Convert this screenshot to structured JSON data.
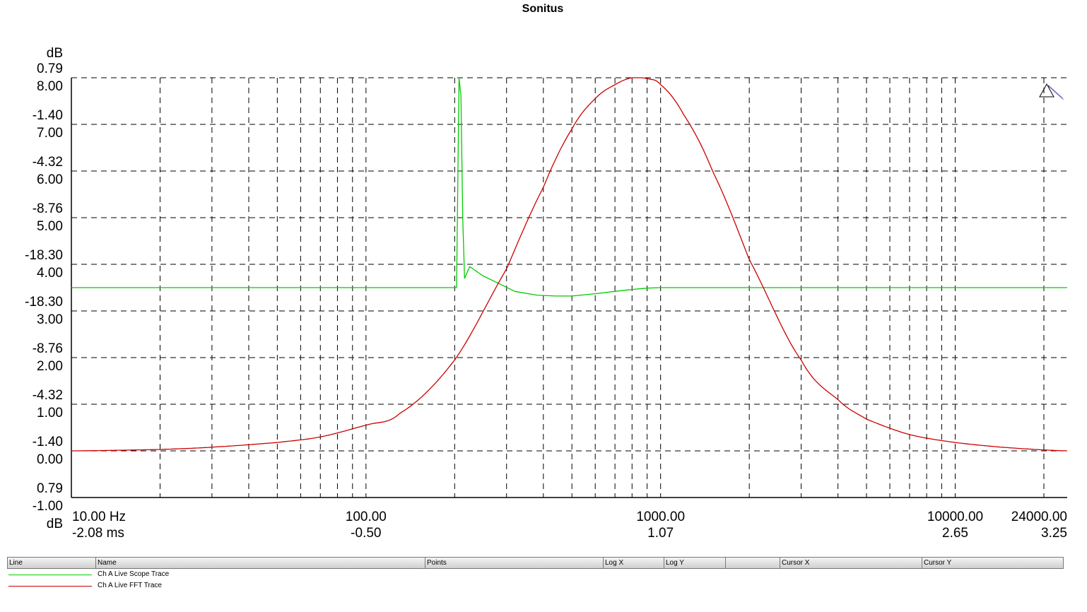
{
  "title": "Sonitus",
  "colors": {
    "scope": "#00cc00",
    "fft": "#cc0000",
    "grid": "#000000"
  },
  "chart_data": {
    "type": "line",
    "title": "Sonitus",
    "grid": true,
    "x_scale": "log",
    "xlim_hz": [
      10,
      24000
    ],
    "ylim_db": [
      -1.0,
      8.0
    ],
    "y_axis_unit_top": "dB",
    "y_axis_unit_bottom": "dB",
    "y_tick_labels": [
      {
        "top": "0.79",
        "bottom": "8.00"
      },
      {
        "top": "-1.40",
        "bottom": "7.00"
      },
      {
        "top": "-4.32",
        "bottom": "6.00"
      },
      {
        "top": "-8.76",
        "bottom": "5.00"
      },
      {
        "top": "-18.30",
        "bottom": "4.00"
      },
      {
        "top": "-18.30",
        "bottom": "3.00"
      },
      {
        "top": "-8.76",
        "bottom": "2.00"
      },
      {
        "top": "-4.32",
        "bottom": "1.00"
      },
      {
        "top": "-1.40",
        "bottom": "0.00"
      },
      {
        "top": "0.79",
        "bottom": "-1.00"
      }
    ],
    "x_tick_labels": [
      {
        "hz": 10,
        "freq": "10.00 Hz",
        "time": "-2.08 ms"
      },
      {
        "hz": 100,
        "freq": "100.00",
        "time": "-0.50"
      },
      {
        "hz": 1000,
        "freq": "1000.00",
        "time": "1.07"
      },
      {
        "hz": 10000,
        "freq": "10000.00",
        "time": "2.65"
      },
      {
        "hz": 24000,
        "freq": "24000.00",
        "time": "3.25"
      }
    ],
    "series": [
      {
        "name": "Ch A Live FFT Trace",
        "color": "#cc0000",
        "x": [
          10,
          20,
          30,
          50,
          70,
          100,
          130,
          200,
          300,
          400,
          500,
          600,
          700,
          800,
          900,
          1000,
          1200,
          1500,
          2000,
          3000,
          4000,
          5000,
          7000,
          10000,
          15000,
          24000
        ],
        "y": [
          0.0,
          0.03,
          0.08,
          0.18,
          0.3,
          0.55,
          0.8,
          1.95,
          3.9,
          5.65,
          6.9,
          7.55,
          7.85,
          8.0,
          7.98,
          7.85,
          7.2,
          6.0,
          4.1,
          1.95,
          1.1,
          0.68,
          0.35,
          0.18,
          0.07,
          0.0
        ]
      },
      {
        "name": "Ch A Live Scope Trace",
        "color": "#00cc00",
        "x": [
          10,
          200,
          203,
          207,
          210,
          213,
          216,
          225,
          250,
          280,
          320,
          380,
          440,
          500,
          600,
          700,
          800,
          900,
          1000,
          24000
        ],
        "y": [
          3.5,
          3.5,
          3.5,
          8.0,
          7.6,
          5.0,
          3.7,
          3.95,
          3.75,
          3.6,
          3.42,
          3.34,
          3.32,
          3.32,
          3.37,
          3.42,
          3.46,
          3.49,
          3.5,
          3.5
        ]
      }
    ]
  },
  "legend": {
    "headers": [
      "Line",
      "Name",
      "Points",
      "Log X",
      "Log Y",
      "",
      "Cursor X",
      "Cursor Y"
    ],
    "rows": [
      {
        "name": "Ch A Live Scope Trace",
        "color": "#00cc00"
      },
      {
        "name": "Ch A Live FFT Trace",
        "color": "#cc0000"
      }
    ]
  },
  "marker_icon": "triangle-cursor-icon"
}
